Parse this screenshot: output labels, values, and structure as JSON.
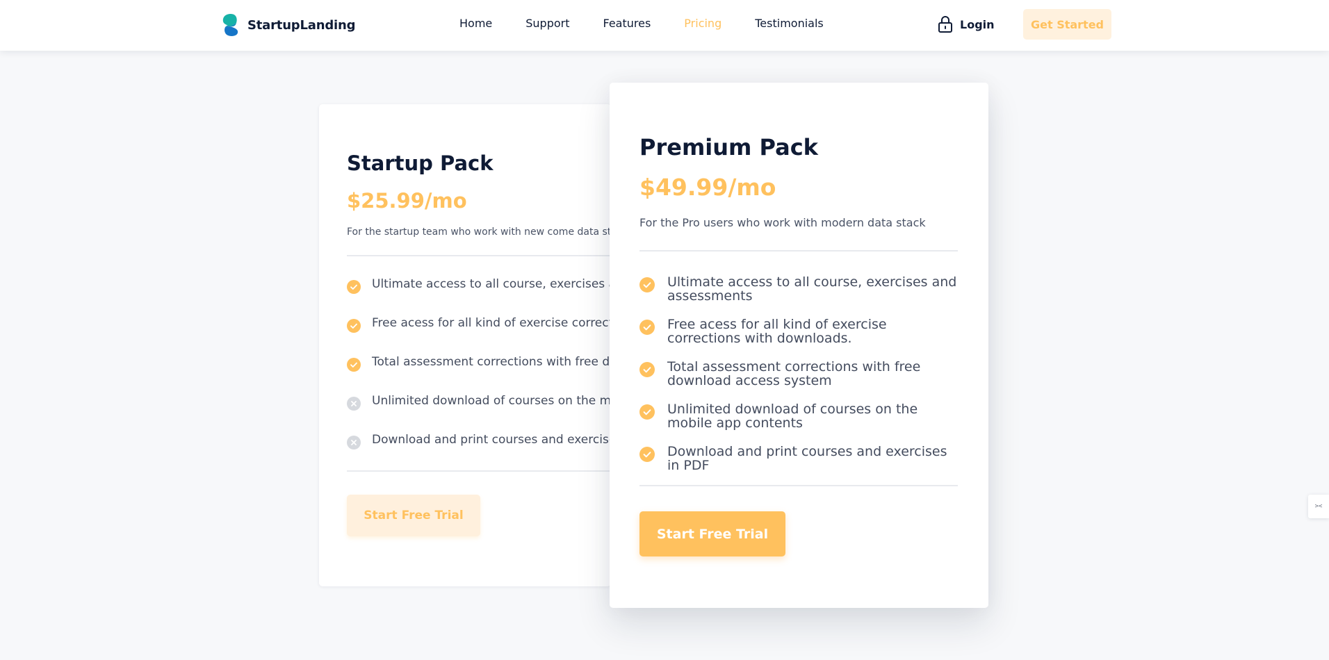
{
  "brand": {
    "name": "StartupLanding",
    "colors": {
      "accent": "#ffc15e",
      "accent_light": "#fff1de",
      "text_dark": "#0f1b35",
      "logo_teal": "#17b2a7",
      "logo_blue": "#1675c7"
    }
  },
  "nav": {
    "links": [
      {
        "label": "Home",
        "active": false
      },
      {
        "label": "Support",
        "active": false
      },
      {
        "label": "Features",
        "active": false
      },
      {
        "label": "Pricing",
        "active": true
      },
      {
        "label": "Testimonials",
        "active": false
      }
    ],
    "login_label": "Login",
    "login_icon": "lock-icon",
    "cta_label": "Get Started"
  },
  "plans": [
    {
      "title": "Startup Pack",
      "price": "$25.99/mo",
      "description": "For the startup team who work with new come data stack",
      "features": [
        {
          "text": "Ultimate access to all course, exercises and assessments",
          "included": true,
          "icon": "check-circle-icon"
        },
        {
          "text": "Free acess for all kind of exercise corrections with downloads.",
          "included": true,
          "icon": "check-circle-icon"
        },
        {
          "text": "Total assessment corrections with free download access system",
          "included": true,
          "icon": "check-circle-icon"
        },
        {
          "text": "Unlimited download of courses on the mobile app contents",
          "included": false,
          "icon": "x-circle-icon"
        },
        {
          "text": "Download and print courses and exercises in PDF",
          "included": false,
          "icon": "x-circle-icon"
        }
      ],
      "button_label": "Start Free Trial"
    },
    {
      "title": "Premium Pack",
      "price": "$49.99/mo",
      "description": "For the Pro users who work with modern data stack",
      "features": [
        {
          "text": "Ultimate access to all course, exercises and assessments",
          "included": true,
          "icon": "check-circle-icon"
        },
        {
          "text": "Free acess for all kind of exercise corrections with downloads.",
          "included": true,
          "icon": "check-circle-icon"
        },
        {
          "text": "Total assessment corrections with free download access system",
          "included": true,
          "icon": "check-circle-icon"
        },
        {
          "text": "Unlimited download of courses on the mobile app contents",
          "included": true,
          "icon": "check-circle-icon"
        },
        {
          "text": "Download and print courses and exercises in PDF",
          "included": true,
          "icon": "check-circle-icon"
        }
      ],
      "button_label": "Start Free Trial"
    }
  ],
  "side_widget": {
    "icon": "devtools-icon",
    "label": "><"
  }
}
